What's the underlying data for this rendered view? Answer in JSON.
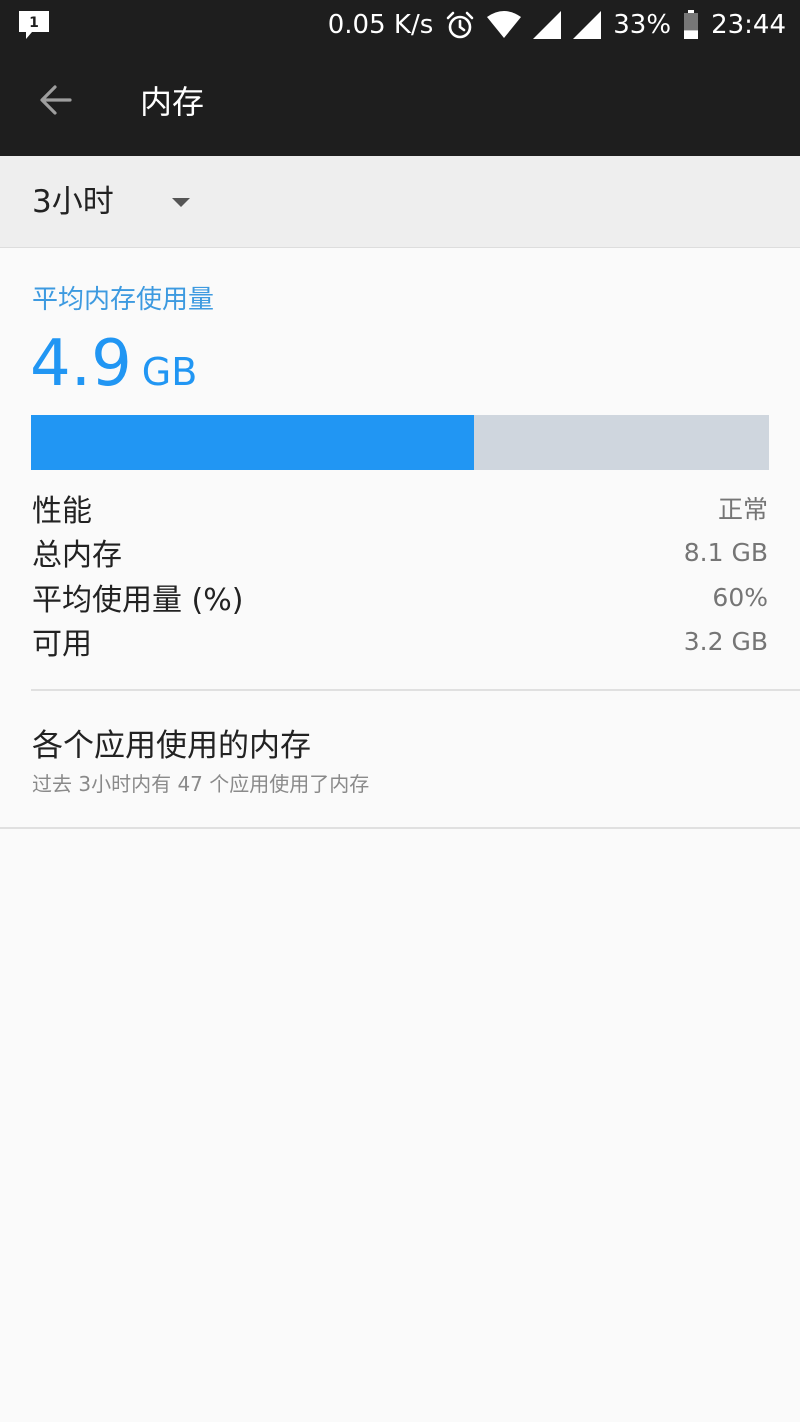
{
  "status_bar": {
    "notification_count": "1",
    "network_speed": "0.05 K/s",
    "battery": "33%",
    "battery_level": 0.33,
    "time": "23:44",
    "icons": [
      "notification-icon",
      "alarm-icon",
      "wifi-icon",
      "signal-icon",
      "signal-icon",
      "battery-icon"
    ]
  },
  "app_bar": {
    "title": "内存",
    "back_icon": "arrow-back-icon"
  },
  "period": {
    "selected": "3小时",
    "icon": "dropdown-arrow-icon"
  },
  "summary": {
    "label": "平均内存使用量",
    "value": "4.9",
    "unit": "GB",
    "usage_fraction": 0.6
  },
  "stats": [
    {
      "label": "性能",
      "value": "正常"
    },
    {
      "label": "总内存",
      "value": "8.1 GB"
    },
    {
      "label": "平均使用量 (%)",
      "value": "60%"
    },
    {
      "label": "可用",
      "value": "3.2 GB"
    }
  ],
  "app_memory": {
    "title": "各个应用使用的内存",
    "summary": "过去 3小时内有 47 个应用使用了内存"
  },
  "colors": {
    "accent": "#2196f3",
    "toolbar": "#1e1e1e",
    "bar_track": "#cfd6de"
  }
}
